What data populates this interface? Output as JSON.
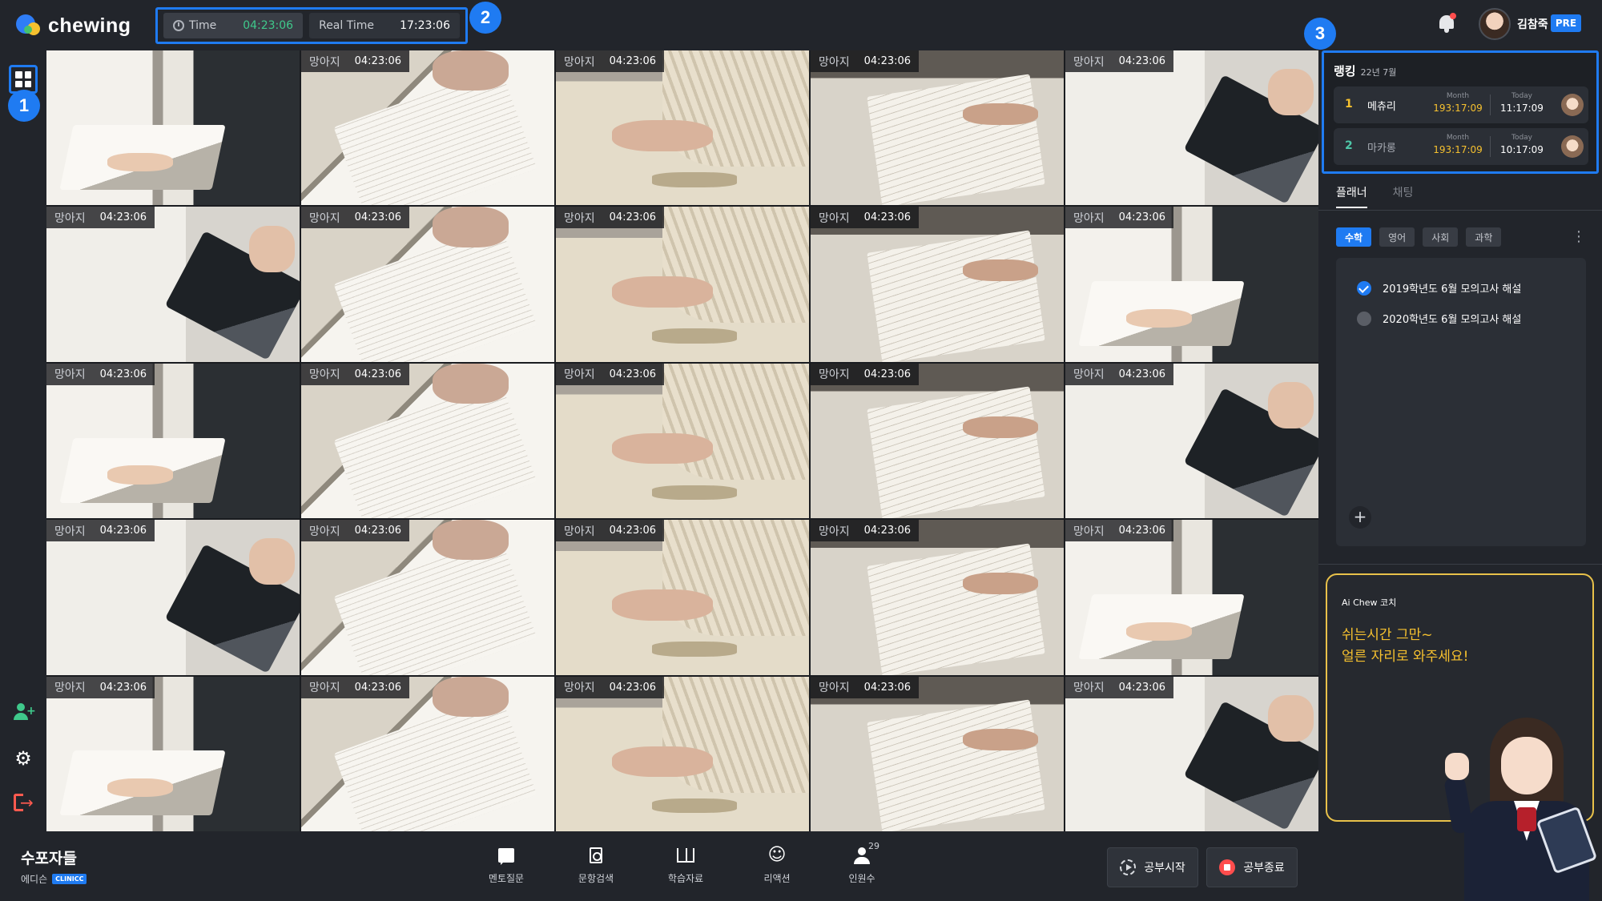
{
  "app": {
    "logo_text": "chewing",
    "accent": "#1f7bf2",
    "highlight": "#3fc98b",
    "gold": "#f6c12f"
  },
  "timebar": {
    "time_label": "Time",
    "time_value": "04:23:06",
    "real_label": "Real Time",
    "real_value": "17:23:06"
  },
  "callouts": [
    "1",
    "2",
    "3"
  ],
  "user": {
    "name": "김참죽",
    "tier": "PRE"
  },
  "tiles": [
    {
      "name": "",
      "time": ""
    },
    {
      "name": "망아지",
      "time": "04:23:06"
    },
    {
      "name": "망아지",
      "time": "04:23:06"
    },
    {
      "name": "망아지",
      "time": "04:23:06"
    },
    {
      "name": "망아지",
      "time": "04:23:06"
    },
    {
      "name": "망아지",
      "time": "04:23:06"
    },
    {
      "name": "망아지",
      "time": "04:23:06"
    },
    {
      "name": "망아지",
      "time": "04:23:06"
    },
    {
      "name": "망아지",
      "time": "04:23:06"
    },
    {
      "name": "망아지",
      "time": "04:23:06"
    },
    {
      "name": "망아지",
      "time": "04:23:06"
    },
    {
      "name": "망아지",
      "time": "04:23:06"
    },
    {
      "name": "망아지",
      "time": "04:23:06"
    },
    {
      "name": "망아지",
      "time": "04:23:06"
    },
    {
      "name": "망아지",
      "time": "04:23:06"
    },
    {
      "name": "망아지",
      "time": "04:23:06"
    },
    {
      "name": "망아지",
      "time": "04:23:06"
    },
    {
      "name": "망아지",
      "time": "04:23:06"
    },
    {
      "name": "망아지",
      "time": "04:23:06"
    },
    {
      "name": "망아지",
      "time": "04:23:06"
    },
    {
      "name": "망아지",
      "time": "04:23:06"
    },
    {
      "name": "망아지",
      "time": "04:23:06"
    },
    {
      "name": "망아지",
      "time": "04:23:06"
    },
    {
      "name": "망아지",
      "time": "04:23:06"
    },
    {
      "name": "망아지",
      "time": "04:23:06"
    }
  ],
  "ranking": {
    "title": "랭킹",
    "period": "22년 7월",
    "month_label": "Month",
    "today_label": "Today",
    "rows": [
      {
        "rank": "1",
        "name": "메츄리",
        "month": "193:17:09",
        "today": "11:17:09"
      },
      {
        "rank": "2",
        "name": "마카롱",
        "month": "193:17:09",
        "today": "10:17:09"
      }
    ]
  },
  "panel": {
    "tabs": [
      "플래너",
      "채팅"
    ],
    "subjects": [
      "수학",
      "영어",
      "사회",
      "과학"
    ],
    "tasks": [
      {
        "title": "2019학년도 6월 모의고사 해설",
        "done": true
      },
      {
        "title": "2020학년도 6월 모의고사 해설",
        "done": false
      }
    ],
    "add_label": "+"
  },
  "coach": {
    "label": "Ai Chew 코치",
    "line1": "쉬는시간 그만~",
    "line2": "얼른 자리로 와주세요!"
  },
  "room": {
    "title": "수포자들",
    "host": "에디슨",
    "host_badge": "CLINICC"
  },
  "bottom_nav": [
    {
      "label": "멘토질문",
      "icon": "chat-icon"
    },
    {
      "label": "문항검색",
      "icon": "doc-search-icon"
    },
    {
      "label": "학습자료",
      "icon": "book-icon"
    },
    {
      "label": "리액션",
      "icon": "smile-icon"
    },
    {
      "label": "인원수",
      "icon": "person-icon",
      "count": "29"
    }
  ],
  "actions": {
    "start": "공부시작",
    "end": "공부종료"
  }
}
